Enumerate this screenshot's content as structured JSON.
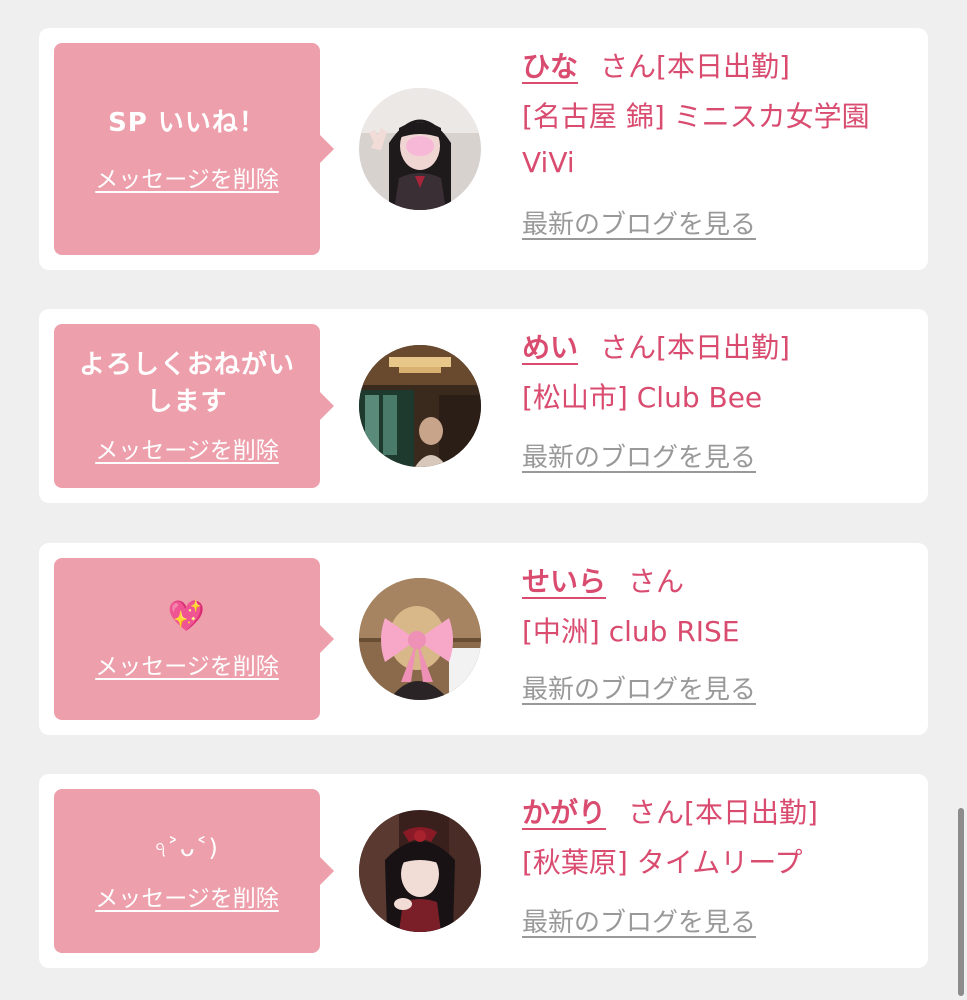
{
  "colors": {
    "background": "#efefef",
    "card": "#ffffff",
    "bubble": "#ed9fab",
    "accent": "#d94c70",
    "link_gray": "#999999"
  },
  "delete_label": "メッセージを削除",
  "blog_label": "最新のブログを見る",
  "items": [
    {
      "message": "SP いいね！",
      "name": "ひな",
      "honorific": "さん",
      "status": "[本日出勤]",
      "shop": "[名古屋 錦] ミニスカ女学園ViVi"
    },
    {
      "message": "よろしくおねがいします",
      "name": "めい",
      "honorific": "さん",
      "status": "[本日出勤]",
      "shop": "[松山市] Club Bee"
    },
    {
      "message": "💖",
      "name": "せいら",
      "honorific": "さん",
      "status": "",
      "shop": "[中洲] club RISE"
    },
    {
      "message": "ঀ˃ᴗ˂)",
      "name": "かがり",
      "honorific": "さん",
      "status": "[本日出勤]",
      "shop": "[秋葉原] タイムリープ"
    }
  ]
}
